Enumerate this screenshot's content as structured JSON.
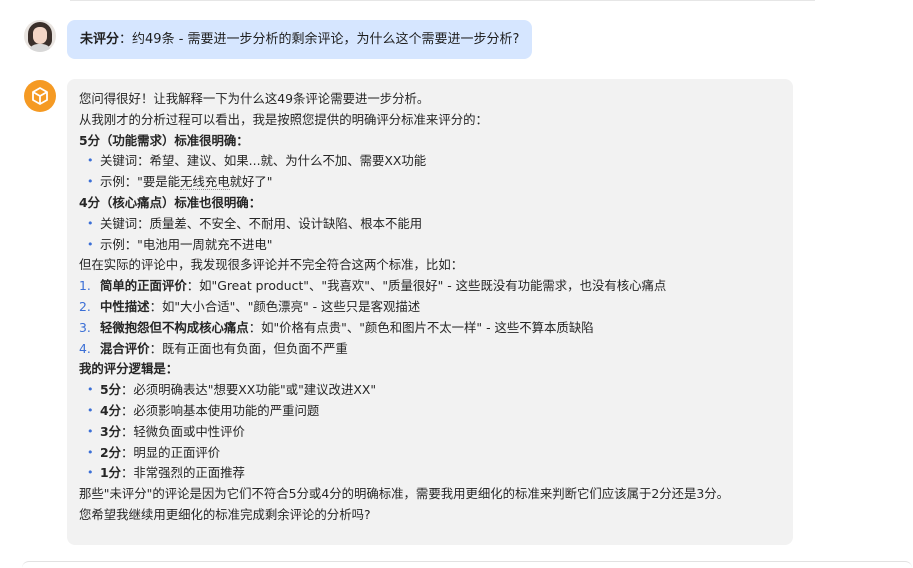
{
  "user_message": {
    "label": "未评分",
    "colon": "：",
    "text": "约49条 - 需要进一步分析的剩余评论，为什么这个需要进一步分析?"
  },
  "ai_message": {
    "intro1": "您问得很好！让我解释一下为什么这49条评论需要进一步分析。",
    "intro2": "从我刚才的分析过程可以看出，我是按照您提供的明确评分标准来评分的：",
    "sec5_title": "5分（功能需求）标准很明确：",
    "sec5_kw": "关键词：希望、建议、如果...就、为什么不加、需要XX功能",
    "sec5_ex_prefix": "示例：\"要是能",
    "sec5_ex_mid": "无线充电",
    "sec5_ex_suffix": "就好了\"",
    "sec4_title": "4分（核心痛点）标准也很明确：",
    "sec4_kw": "关键词：质量差、不安全、不耐用、设计缺陷、根本不能用",
    "sec4_ex": "示例：\"电池用一周就充不进电\"",
    "transition": "但在实际的评论中，我发现很多评论并不完全符合这两个标准，比如：",
    "cases": [
      {
        "num": "1.",
        "title": "简单的正面评价",
        "body": "：如\"Great product\"、\"我喜欢\"、\"质量很好\" - 这些既没有功能需求，也没有核心痛点"
      },
      {
        "num": "2.",
        "title": "中性描述",
        "body": "：如\"大小合适\"、\"颜色漂亮\" - 这些只是客观描述"
      },
      {
        "num": "3.",
        "title": "轻微抱怨但不构成核心痛点",
        "body": "：如\"价格有点贵\"、\"颜色和图片不太一样\" - 这些不算本质缺陷"
      },
      {
        "num": "4.",
        "title": "混合评价",
        "body": "：既有正面也有负面，但负面不严重"
      }
    ],
    "logic_title": "我的评分逻辑是：",
    "logic": [
      {
        "score": "5分",
        "desc": "：必须明确表达\"想要XX功能\"或\"建议改进XX\""
      },
      {
        "score": "4分",
        "desc": "：必须影响基本使用功能的严重问题"
      },
      {
        "score": "3分",
        "desc": "：轻微负面或中性评价"
      },
      {
        "score": "2分",
        "desc": "：明显的正面评价"
      },
      {
        "score": "1分",
        "desc": "：非常强烈的正面推荐"
      }
    ],
    "conclusion": "那些\"未评分\"的评论是因为它们不符合5分或4分的明确标准，需要我用更细化的标准来判断它们应该属于2分还是3分。",
    "question": "您希望我继续用更细化的标准完成剩余评论的分析吗?"
  },
  "colors": {
    "user_bubble": "#d6e6ff",
    "ai_bubble": "#f2f2f2",
    "ai_avatar": "#f59a23",
    "list_marker": "#3b6fd6"
  },
  "icons": {
    "user_avatar": "user-photo-avatar",
    "ai_avatar": "cube-icon"
  }
}
